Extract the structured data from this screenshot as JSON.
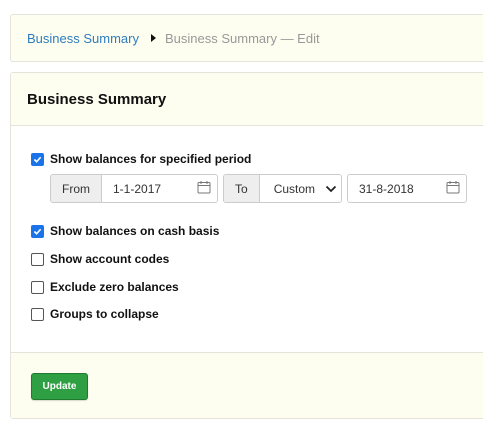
{
  "breadcrumb": {
    "link": "Business Summary",
    "current": "Business Summary — Edit"
  },
  "panel": {
    "title": "Business Summary"
  },
  "options": {
    "specified_period": {
      "label": "Show balances for specified period",
      "checked": true
    },
    "cash_basis": {
      "label": "Show balances on cash basis",
      "checked": true
    },
    "account_codes": {
      "label": "Show account codes",
      "checked": false
    },
    "exclude_zero": {
      "label": "Exclude zero balances",
      "checked": false
    },
    "groups_collapse": {
      "label": "Groups to collapse",
      "checked": false
    }
  },
  "period": {
    "from_label": "From",
    "from_value": "1-1-2017",
    "to_label": "To",
    "to_mode": "Custom",
    "to_value": "31-8-2018"
  },
  "footer": {
    "update_label": "Update"
  },
  "colors": {
    "accent": "#1a73e8",
    "link": "#2f7dbd",
    "update_button": "#2ea043",
    "panel_tint": "#fdfdf0"
  }
}
